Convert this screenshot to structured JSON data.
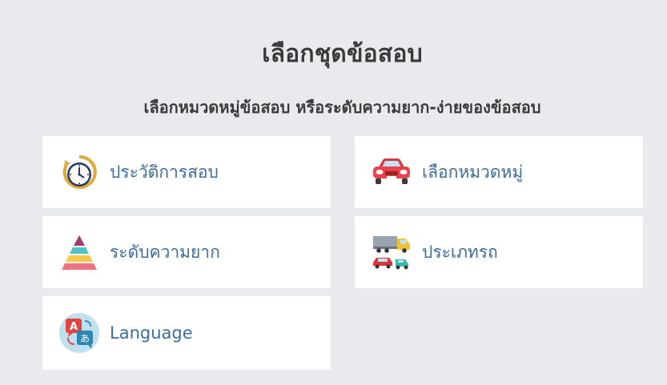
{
  "header": {
    "title": "เลือกชุดข้อสอบ",
    "subtitle": "เลือกหมวดหมู่ข้อสอบ หรือระดับความยาก-ง่ายของข้อสอบ"
  },
  "options": [
    {
      "label": "ประวัติการสอบ",
      "icon": "stopwatch-icon"
    },
    {
      "label": "เลือกหมวดหมู่",
      "icon": "red-car-icon"
    },
    {
      "label": "ระดับความยาก",
      "icon": "pyramid-icon"
    },
    {
      "label": "ประเภทรถ",
      "icon": "vehicles-icon"
    },
    {
      "label": "Language",
      "icon": "translate-icon"
    }
  ],
  "colors": {
    "background": "#e9eaee",
    "card": "#ffffff",
    "label": "#3d6c9e",
    "title": "#3a3a3a"
  }
}
